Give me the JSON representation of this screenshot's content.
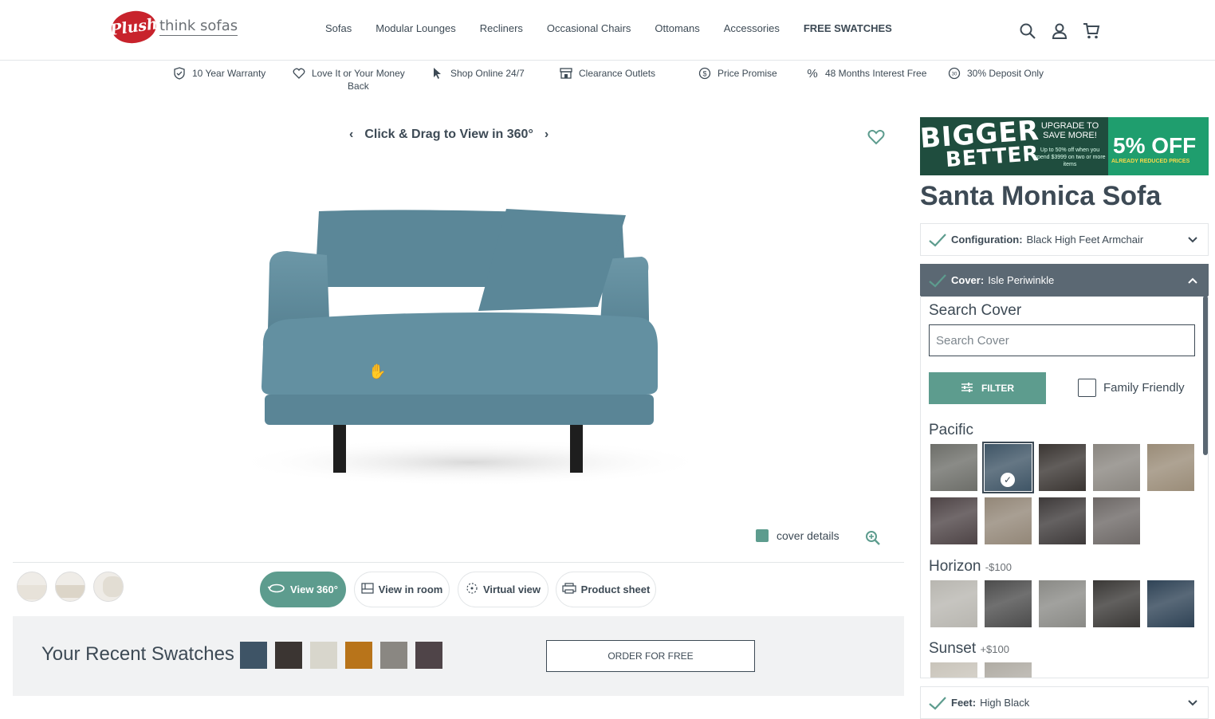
{
  "header": {
    "logo_badge": "Plush",
    "logo_text": "think sofas",
    "nav": [
      "Sofas",
      "Modular Lounges",
      "Recliners",
      "Occasional Chairs",
      "Ottomans",
      "Accessories",
      "FREE SWATCHES"
    ]
  },
  "usp": {
    "warranty": "10 Year Warranty",
    "money_back_1": "Love It or Your Money",
    "money_back_2": "Back",
    "shop": "Shop Online 24/7",
    "clearance": "Clearance Outlets",
    "price": "Price Promise",
    "interest": "48 Months Interest Free",
    "deposit": "30% Deposit Only"
  },
  "viewer": {
    "drag_label": "Click & Drag to View in 360°",
    "cover_details": "cover details",
    "buttons": {
      "view360": "View 360°",
      "room": "View in room",
      "virtual": "Virtual view",
      "sheet": "Product sheet"
    }
  },
  "recent": {
    "title": "Your Recent Swatches",
    "order_label": "ORDER FOR FREE",
    "swatches": [
      "#3e5466",
      "#3b3532",
      "#d8d6cc",
      "#b8741a",
      "#8a8782",
      "#4f4448"
    ]
  },
  "panel": {
    "banner_l1": "BIGGER",
    "banner_l2": "BETTER",
    "banner_upgrade": "UPGRADE TO SAVE MORE!",
    "banner_small": "Up to 50% off when you spend $3999 on two or more items",
    "banner_off": "5% OFF",
    "banner_off_sub": "ALREADY REDUCED PRICES",
    "product_name": "Santa Monica Sofa",
    "config_label": "Configuration:",
    "config_value": "Black High Feet Armchair",
    "cover_label": "Cover:",
    "cover_value": "Isle Periwinkle",
    "search_title": "Search Cover",
    "search_placeholder": "Search Cover",
    "filter_label": "FILTER",
    "family_friendly": "Family Friendly",
    "groups": {
      "pacific": "Pacific",
      "horizon": "Horizon",
      "horizon_price": "-$100",
      "sunset": "Sunset",
      "sunset_price": "+$100"
    },
    "feet_label": "Feet:",
    "feet_value": "High Black"
  },
  "colors": {
    "accent": "#5d9c8e",
    "dark": "#3d4a55",
    "sofa": "#5a8596"
  }
}
